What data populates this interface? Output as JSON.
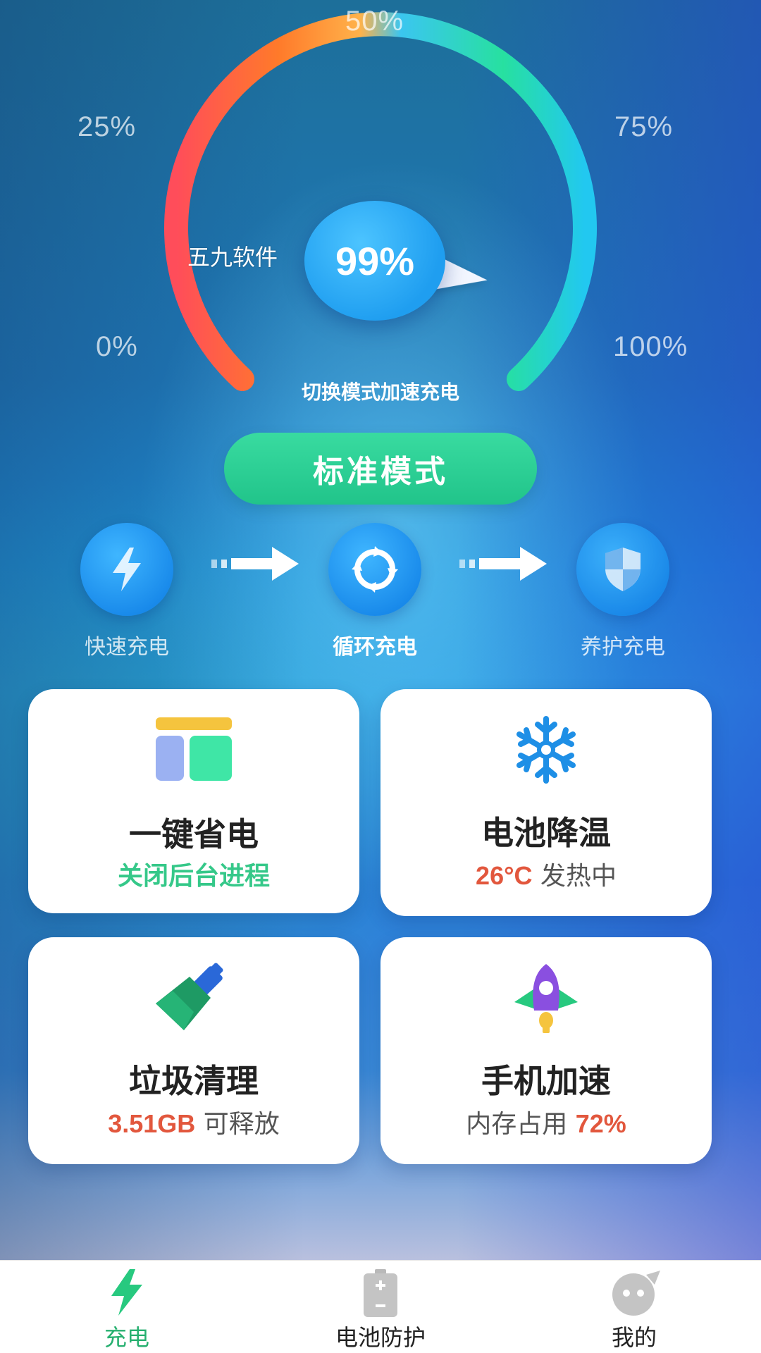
{
  "gauge": {
    "labels": {
      "p0": "0%",
      "p25": "25%",
      "p50": "50%",
      "p75": "75%",
      "p100": "100%"
    },
    "value_text": "99%",
    "level": 0.99,
    "hint": "切换模式加速充电"
  },
  "watermark": "五九软件",
  "mode_button": "标准模式",
  "steps": [
    {
      "label": "快速充电",
      "icon": "lightning-icon"
    },
    {
      "label": "循环充电",
      "icon": "cycle-icon"
    },
    {
      "label": "养护充电",
      "icon": "shield-icon"
    }
  ],
  "cards": {
    "save_power": {
      "title": "一键省电",
      "sub": "关闭后台进程",
      "icon": "layout-icon"
    },
    "cooling": {
      "title": "电池降温",
      "temp": "26°C",
      "sub": "发热中",
      "icon": "snowflake-icon"
    },
    "cleanup": {
      "title": "垃圾清理",
      "size": "3.51GB",
      "sub": "可释放",
      "icon": "broom-icon"
    },
    "speedup": {
      "title": "手机加速",
      "sub": "内存占用",
      "percent": "72%",
      "icon": "rocket-icon"
    }
  },
  "tabbar": [
    {
      "label": "充电",
      "icon": "lightning-tab-icon",
      "active": true
    },
    {
      "label": "电池防护",
      "icon": "battery-icon",
      "active": false
    },
    {
      "label": "我的",
      "icon": "profile-icon",
      "active": false
    }
  ],
  "colors": {
    "accent_green": "#35c889",
    "accent_red": "#e2573d",
    "tab_active": "#27b070",
    "button_green": "#21c48a"
  }
}
